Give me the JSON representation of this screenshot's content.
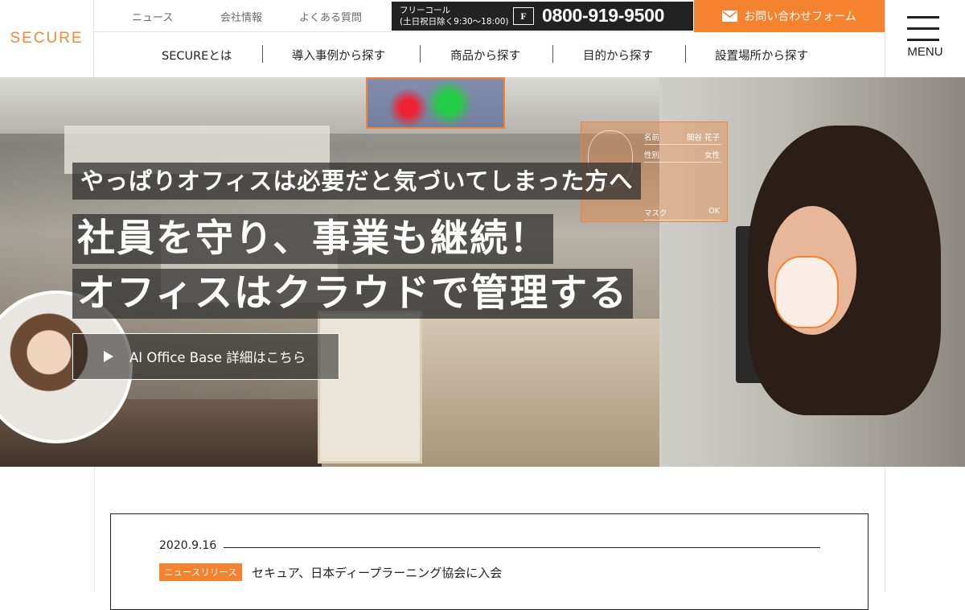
{
  "header": {
    "logo": "SECURE",
    "util_links": [
      "ニュース",
      "会社情報",
      "よくある質問"
    ],
    "freecall": {
      "label": "フリーコール",
      "hours": "(土日祝日除く9:30〜18:00)",
      "badge": "F",
      "number": "0800-919-9500"
    },
    "contact_button": "お問い合わせフォーム",
    "nav": [
      "SECUREとは",
      "導入事例から探す",
      "商品から探す",
      "目的から探す",
      "設置場所から探す"
    ],
    "menu_label": "MENU"
  },
  "hero": {
    "tagline": "やっぱりオフィスは必要だと気づいてしまった方へ",
    "headline_1": "社員を守り、事業も継続！",
    "headline_2": "オフィスはクラウドで管理する",
    "cta": "AI Office Base 詳細はこちら",
    "face_panel": [
      {
        "key": "名前",
        "value": "関谷 花子"
      },
      {
        "key": "性別",
        "value": "女性"
      },
      {
        "key": "マスク",
        "value": "OK"
      }
    ]
  },
  "news": {
    "date": "2020.9.16",
    "badge": "ニュースリリース",
    "title": "セキュア、日本ディープラーニング協会に入会"
  },
  "colors": {
    "accent": "#f5822f",
    "logo": "#f08a35",
    "dark": "#222222"
  },
  "icons": [
    "mail-icon",
    "play-icon",
    "menu-icon"
  ]
}
